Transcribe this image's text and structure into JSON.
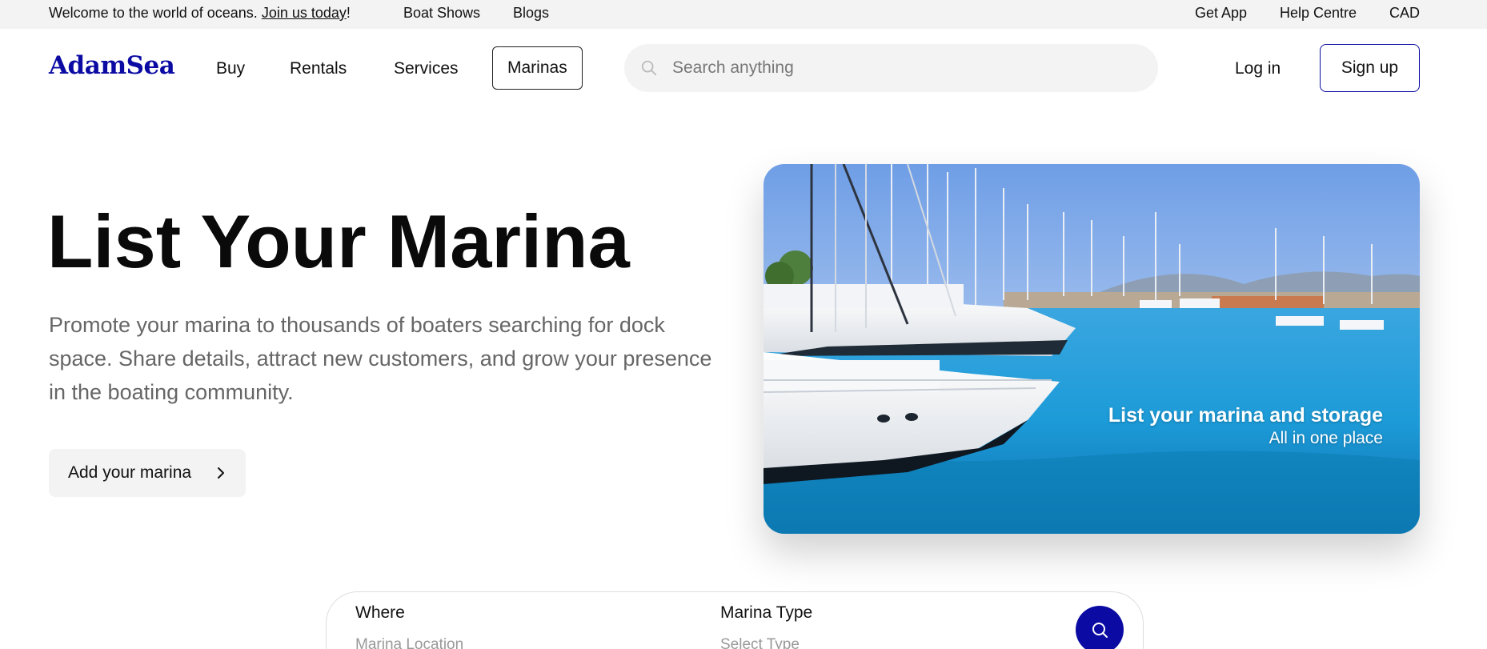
{
  "topbar": {
    "welcome_prefix": "Welcome to the world of oceans. ",
    "join_link": "Join us today",
    "welcome_suffix": "!",
    "links": [
      "Boat Shows",
      "Blogs"
    ],
    "right_links": [
      "Get App",
      "Help Centre",
      "CAD"
    ]
  },
  "header": {
    "logo": "AdamSea",
    "nav": [
      "Buy",
      "Rentals",
      "Services",
      "Marinas"
    ],
    "active_nav": "Marinas",
    "search_placeholder": "Search anything",
    "login": "Log in",
    "signup": "Sign up"
  },
  "hero": {
    "title": "List Your Marina",
    "description": "Promote your marina to thousands of boaters searching for dock space. Share details, attract new customers, and grow your presence in the boating community.",
    "cta": "Add your marina",
    "card_title": "List your marina and storage",
    "card_subtitle": "All in one place"
  },
  "finder": {
    "where_label": "Where",
    "where_placeholder": "Marina Location",
    "type_label": "Marina Type",
    "type_placeholder": "Select Type"
  },
  "colors": {
    "brand": "#0b0ba3",
    "topbar_bg": "#f3f3f3",
    "muted_text": "#666666"
  }
}
